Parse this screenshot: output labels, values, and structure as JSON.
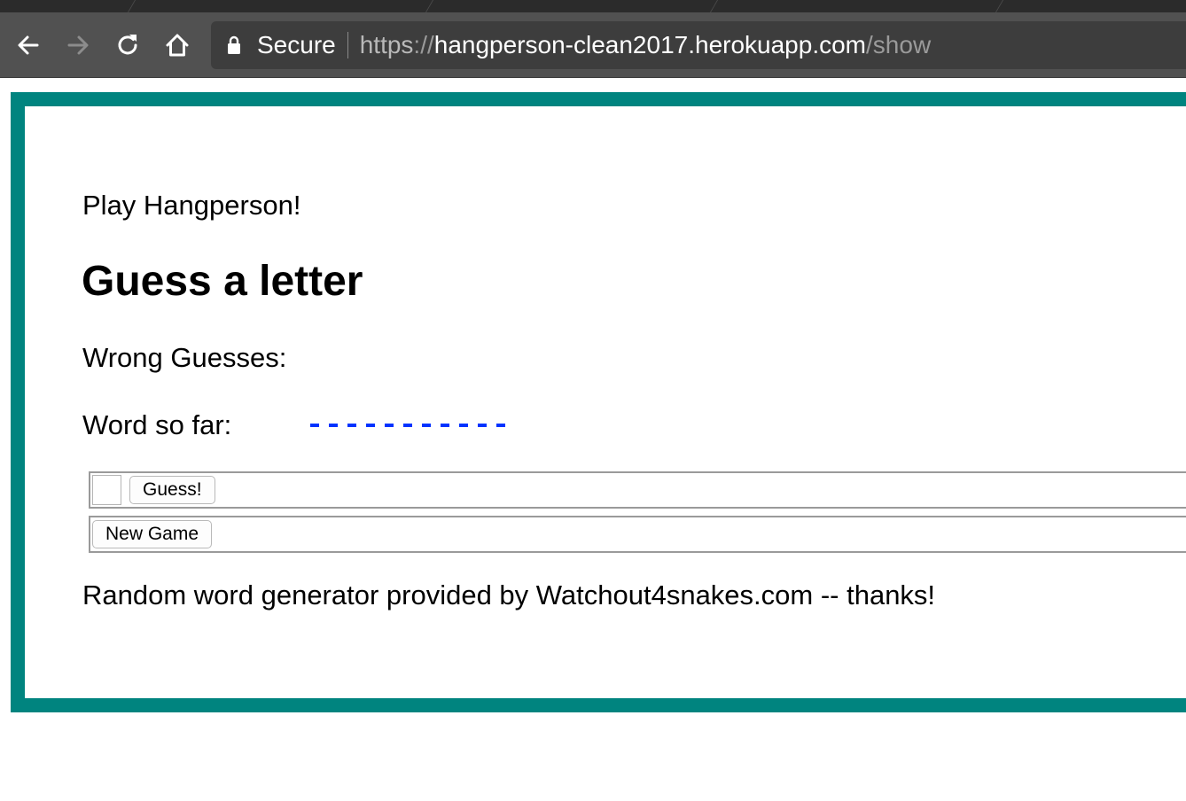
{
  "browser": {
    "security_label": "Secure",
    "url": {
      "scheme": "https",
      "separator": "://",
      "host": "hangperson-clean2017.herokuapp.com",
      "path": "/show"
    },
    "icons": {
      "back": "back-arrow-icon",
      "forward": "forward-arrow-icon",
      "reload": "reload-icon",
      "home": "home-icon",
      "lock": "lock-icon"
    }
  },
  "page": {
    "intro": "Play Hangperson!",
    "heading": "Guess a letter",
    "wrong_guesses_label": "Wrong Guesses:",
    "wrong_guesses_value": "",
    "word_so_far_label": "Word so far:",
    "word_so_far_value": "-----------",
    "guess_input_value": "",
    "guess_button_label": "Guess!",
    "new_game_button_label": "New Game",
    "credit": "Random word generator provided by Watchout4snakes.com -- thanks!"
  },
  "colors": {
    "frame_border": "#00847f",
    "word_dashes": "#0033ff",
    "toolbar": "#515151",
    "omnibox": "#3d3d3d"
  }
}
